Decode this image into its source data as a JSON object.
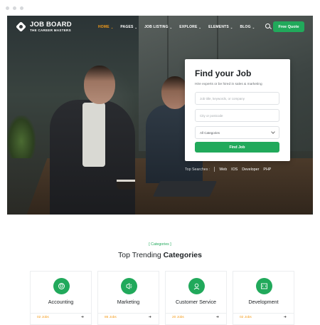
{
  "colors": {
    "accent": "#21a95b",
    "active_nav": "#f59c1a",
    "hero_dark": "#2b3436"
  },
  "nav": {
    "logo_title": "JOB BOARD",
    "logo_sub": "THE CAREER MASTERS",
    "items": [
      {
        "label": "HOME"
      },
      {
        "label": "PAGES"
      },
      {
        "label": "JOB LISTING"
      },
      {
        "label": "EXPLORE"
      },
      {
        "label": "ELEMENTS"
      },
      {
        "label": "BLOG"
      }
    ],
    "quote_label": "Free Quote"
  },
  "search_card": {
    "title": "Find your Job",
    "subtitle": "Hire experts or be hired in sales & marketing",
    "keyword_placeholder": "Job title, keywords, or company",
    "location_placeholder": "City or postcode",
    "category_value": "All Categories",
    "button_label": "Find Job"
  },
  "top_searches": {
    "label": "Top Searches :",
    "tags": [
      "Web",
      "IOS",
      "Developer",
      "PHP"
    ]
  },
  "categories": {
    "label": "[ Categories ]",
    "heading_plain": "Top Trending ",
    "heading_bold": "Categories",
    "items": [
      {
        "name": "Accounting",
        "jobs": "02 Jobs",
        "icon": "calculator-icon"
      },
      {
        "name": "Marketing",
        "jobs": "86 Jobs",
        "icon": "megaphone-icon"
      },
      {
        "name": "Customer Service",
        "jobs": "20 Jobs",
        "icon": "headset-icon"
      },
      {
        "name": "Development",
        "jobs": "02 Jobs",
        "icon": "code-icon"
      }
    ]
  }
}
